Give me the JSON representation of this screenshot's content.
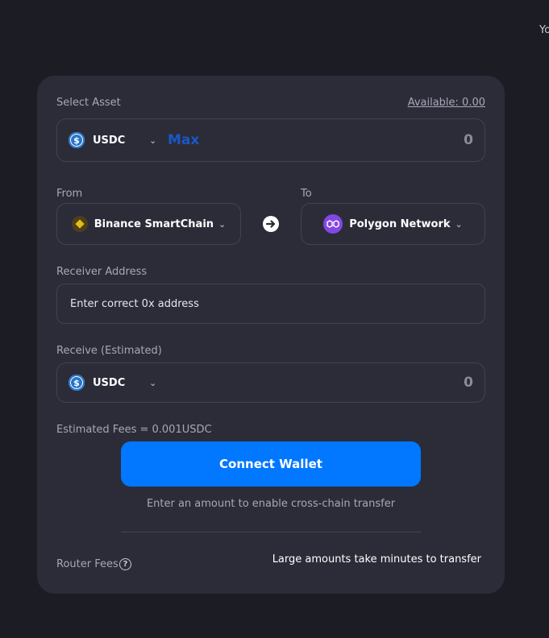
{
  "header": {
    "corner_text": "Yo"
  },
  "form": {
    "select_asset_label": "Select Asset",
    "available_label": "Available: 0.00",
    "asset": {
      "symbol": "USDC",
      "icon": "usdc-icon",
      "color": "#2775ca"
    },
    "max_label": "Max",
    "amount_value": "0",
    "from_label": "From",
    "to_label": "To",
    "from_chain": {
      "name": "Binance SmartChain",
      "icon": "bnb-icon",
      "color": "#f0b90b"
    },
    "to_chain": {
      "name": "Polygon Network",
      "icon": "polygon-icon",
      "color": "#8247e5"
    },
    "swap_icon": "arrow-right-circle-icon",
    "receiver_label": "Receiver Address",
    "receiver_placeholder": "Enter correct 0x address",
    "receive_label": "Receive (Estimated)",
    "receive_asset": {
      "symbol": "USDC",
      "icon": "usdc-icon"
    },
    "receive_value": "0",
    "estimated_fees": "Estimated Fees = 0.001USDC",
    "connect_label": "Connect Wallet",
    "connect_color": "#0277ff",
    "hint": "Enter an amount to enable cross-chain transfer",
    "router_fees_label": "Router Fees",
    "large_amounts_note": "Large amounts take minutes to transfer"
  }
}
